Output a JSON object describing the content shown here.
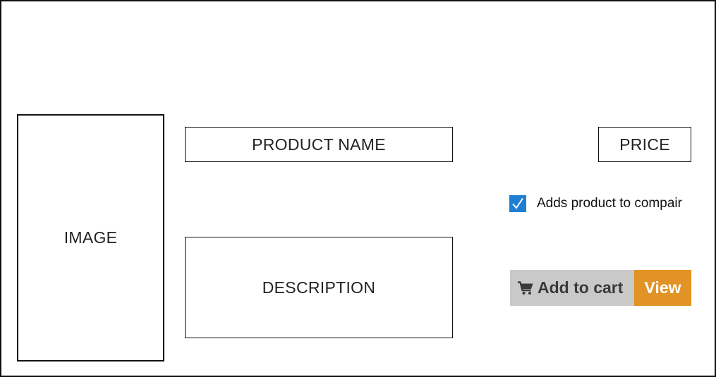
{
  "product": {
    "image_placeholder": "IMAGE",
    "name_placeholder": "PRODUCT NAME",
    "description_placeholder": "DESCRIPTION",
    "price_placeholder": "PRICE"
  },
  "compare": {
    "checked": true,
    "label": "Adds product to compair"
  },
  "actions": {
    "cart_icon": "cart-icon",
    "add_to_cart_label": "Add to cart",
    "view_label": "View"
  },
  "colors": {
    "checkbox": "#1e7fd4",
    "add_to_cart_bg": "#c9c9c9",
    "view_bg": "#e19325"
  }
}
